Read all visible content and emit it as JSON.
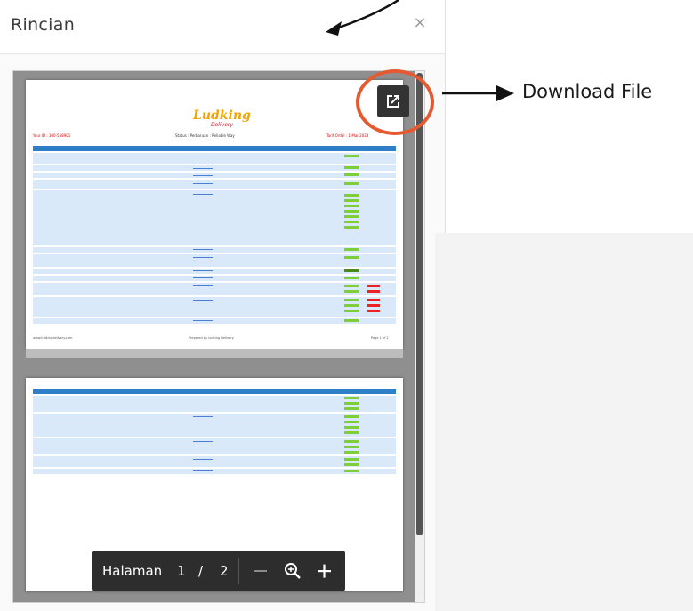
{
  "modal": {
    "title": "Rincian",
    "close_label": "×"
  },
  "document": {
    "logo_text": "Ludking",
    "logo_sub": "Delivery",
    "info_left": "Your ID : 300-568901",
    "info_mid": "Status : Perbaruan : Reliable Way",
    "info_right": "Tarif Ordal : 1-Mar-2023",
    "footer_left": "www.ludkingdelivery.com",
    "footer_mid": "Prepared by ludking Delivery",
    "footer_right": "Page 1 of 2"
  },
  "toolbar": {
    "page_label": "Halaman",
    "current_page": "1",
    "separator": "/",
    "total_pages": "2"
  },
  "annotation": {
    "label": "Download File",
    "arrow_color": "#111111",
    "circle_color": "#e65a32"
  },
  "icons": {
    "close": "close-icon",
    "open_external": "open-in-new-icon",
    "zoom_out": "minus-icon",
    "zoom_fit": "zoom-icon",
    "zoom_in": "plus-icon"
  }
}
